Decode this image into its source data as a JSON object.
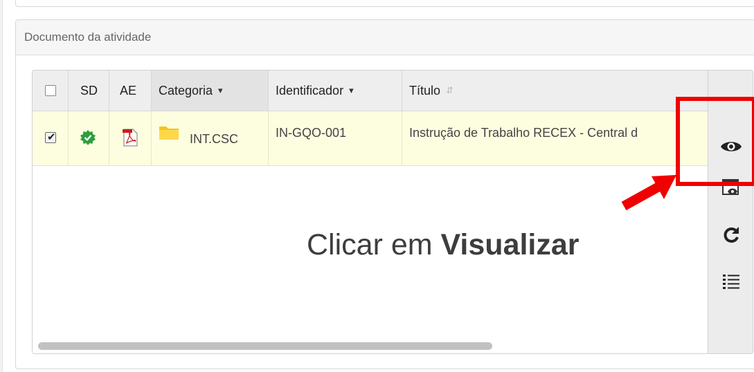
{
  "panel": {
    "title": "Documento da atividade"
  },
  "grid": {
    "columns": [
      {
        "key": "select",
        "label": ""
      },
      {
        "key": "sd",
        "label": "SD"
      },
      {
        "key": "ae",
        "label": "AE"
      },
      {
        "key": "categoria",
        "label": "Categoria",
        "sort": "⬍"
      },
      {
        "key": "identificador",
        "label": "Identificador",
        "sort": "⬍"
      },
      {
        "key": "titulo",
        "label": "Título",
        "sort": "⬍"
      }
    ],
    "rows": [
      {
        "checked": true,
        "sd_icon": "badge-check-icon",
        "ae_icon": "pdf-icon",
        "categoria": "INT.CSC",
        "identificador": "IN-GQO-001",
        "titulo": "Instrução de Trabalho RECEX - Central d"
      }
    ]
  },
  "toolbar": {
    "items": [
      "eye-icon",
      "preview-window-icon",
      "refresh-icon",
      "list-icon"
    ]
  },
  "annotation": {
    "prefix": "Clicar em ",
    "bold": "Visualizar",
    "color": "#f00000"
  },
  "colors": {
    "selected_row": "#fdfde0",
    "header": "#eeeeee",
    "sd_icon_green": "#2e9e3c",
    "pdf_red": "#d11a1a",
    "folder_yellow": "#f5c518"
  }
}
